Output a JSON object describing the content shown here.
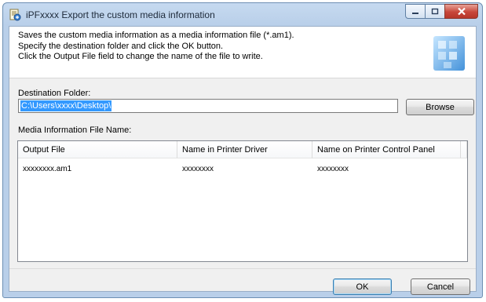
{
  "window": {
    "title": "iPFxxxx Export the custom media information"
  },
  "header": {
    "lines": [
      "Saves the custom media information as a media information file (*.am1).",
      "Specify the destination folder and click the OK button.",
      "Click the Output File field to change the name of the file to write."
    ]
  },
  "destination": {
    "label": "Destination Folder:",
    "value": "C:\\Users\\xxxx\\Desktop\\",
    "browse_label": "Browse"
  },
  "media_list": {
    "label": "Media Information File Name:",
    "columns": [
      "Output File",
      "Name in Printer Driver",
      "Name on Printer Control Panel"
    ],
    "rows": [
      [
        "xxxxxxxx.am1",
        "xxxxxxxx",
        "xxxxxxxx"
      ]
    ]
  },
  "footer": {
    "ok_label": "OK",
    "cancel_label": "Cancel"
  },
  "colors": {
    "selection": "#3399ff",
    "title_bar": "#b9cfe9",
    "close_button": "#c7473a"
  }
}
